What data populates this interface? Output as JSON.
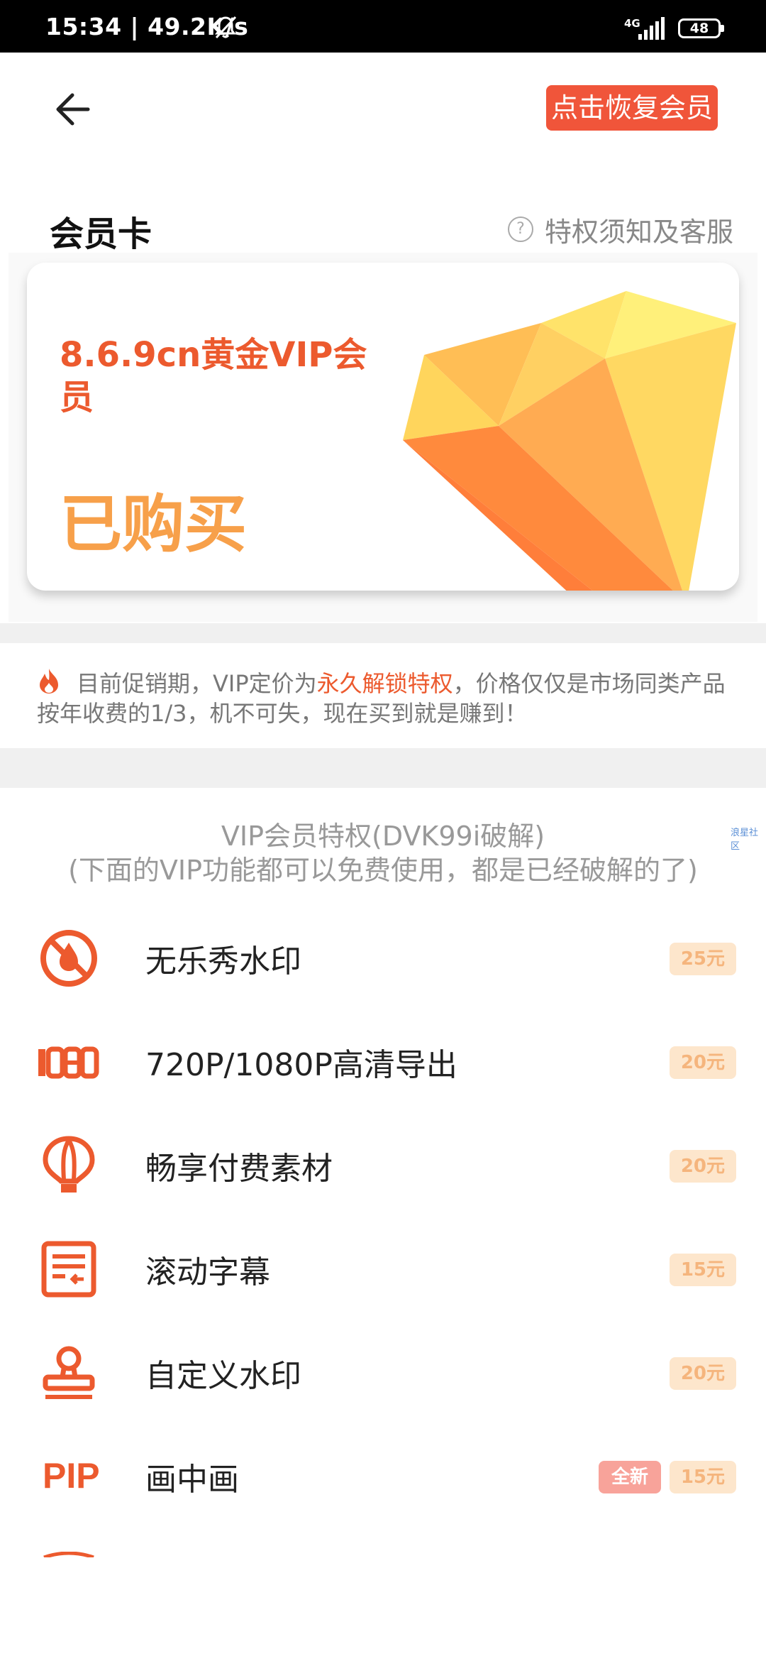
{
  "status_bar": {
    "time": "15:34 | 49.2K/s",
    "network": "4G",
    "battery": "48"
  },
  "header": {
    "restore_label": "点击恢复会员"
  },
  "membership": {
    "section_title": "会员卡",
    "help_link": "特权须知及客服",
    "card_name": "8.6.9cn黄金VIP会员",
    "card_status": "已购买"
  },
  "promo": {
    "text_before": "目前促销期，VIP定价为",
    "highlight": "永久解锁特权",
    "text_after": "，价格仅仅是市场同类产品按年收费的1/3，机不可失，现在买到就是赚到！"
  },
  "privileges": {
    "title_line1": "VIP会员特权(DVK99i破解)",
    "title_line2": "(下面的VIP功能都可以免费使用，都是已经破解的了)",
    "watermark": "浪星社区",
    "items": [
      {
        "name": "无乐秀水印",
        "price": "25元",
        "icon": "no-watermark-icon"
      },
      {
        "name": "720P/1080P高清导出",
        "price": "20元",
        "icon": "hd-1080-icon"
      },
      {
        "name": "畅享付费素材",
        "price": "20元",
        "icon": "hot-air-balloon-icon"
      },
      {
        "name": "滚动字幕",
        "price": "15元",
        "icon": "scrolling-subtitle-icon"
      },
      {
        "name": "自定义水印",
        "price": "20元",
        "icon": "stamp-icon"
      },
      {
        "name": "画中画",
        "price": "15元",
        "badge": "全新",
        "icon_text": "PIP",
        "icon": "pip-icon"
      }
    ]
  },
  "colors": {
    "accent": "#ec5a2e",
    "button": "#f0553a",
    "gold": "#f7a04a",
    "price_bg": "#fde6cc"
  }
}
